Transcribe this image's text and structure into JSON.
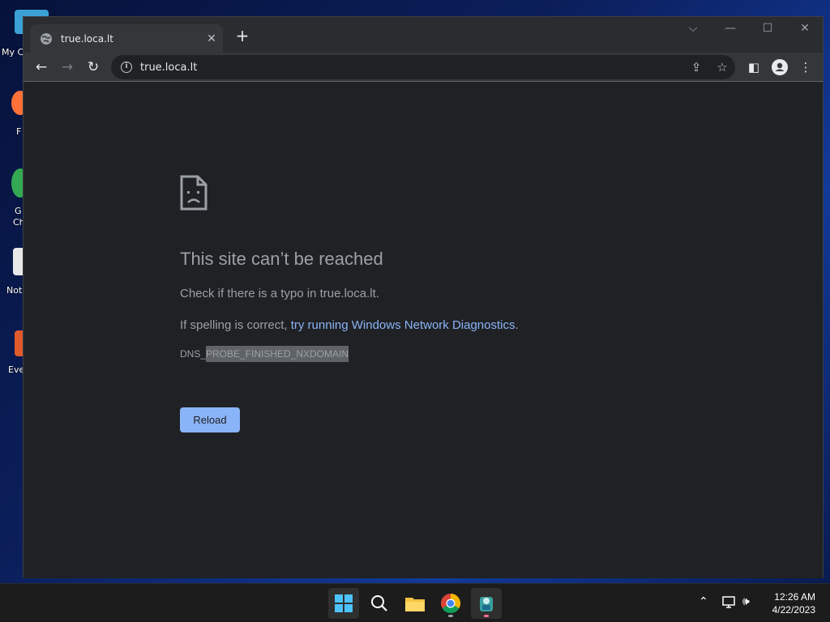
{
  "desktop": {
    "icons": [
      {
        "label": "My C",
        "icon": "this-pc-icon"
      },
      {
        "label": "F",
        "icon": "firefox-icon"
      },
      {
        "label": "G",
        "label2": "Ch",
        "icon": "chrome-icon"
      },
      {
        "label": "Not",
        "icon": "notepad-icon"
      },
      {
        "label": "Eve",
        "icon": "app-icon"
      }
    ]
  },
  "browser": {
    "tab_title": "true.loca.lt",
    "address": "true.loca.lt",
    "icons": {
      "back": "back-arrow-icon",
      "forward": "forward-arrow-icon",
      "reload": "reload-icon",
      "share": "share-icon",
      "bookmark": "star-icon",
      "sidepanel": "side-panel-icon",
      "profile": "profile-icon",
      "menu": "kebab-menu-icon"
    }
  },
  "error_page": {
    "heading": "This site can’t be reached",
    "check_text": "Check if there is a typo in true.loca.lt.",
    "spelling_prefix": "If spelling is correct, ",
    "diagnostics_link": "try running Windows Network Diagnostics",
    "spelling_suffix": ".",
    "error_code_prefix": "DNS_",
    "error_code_selected": "PROBE_FINISHED_NXDOMAIN",
    "reload_label": "Reload"
  },
  "taskbar": {
    "apps": [
      "start-icon",
      "search-icon",
      "file-explorer-icon",
      "chrome-icon",
      "active-app-icon"
    ],
    "time": "12:26 AM",
    "date": "4/22/2023"
  },
  "colors": {
    "page_bg": "#202124",
    "link": "#8ab4f8",
    "text_secondary": "#9aa0a6",
    "button": "#8ab4f8"
  }
}
